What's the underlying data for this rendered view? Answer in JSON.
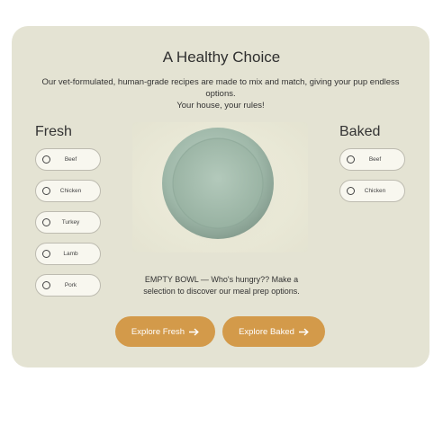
{
  "header": {
    "title": "A Healthy Choice",
    "description_line1": "Our vet-formulated, human-grade recipes are made to mix and match, giving your pup endless options.",
    "description_line2": "Your house, your rules!"
  },
  "fresh": {
    "title": "Fresh",
    "options": [
      "Beef",
      "Chicken",
      "Turkey",
      "Lamb",
      "Pork"
    ]
  },
  "baked": {
    "title": "Baked",
    "options": [
      "Beef",
      "Chicken"
    ]
  },
  "bowl": {
    "status_text": "EMPTY BOWL — Who's hungry?? Make a selection to discover our meal prep options."
  },
  "buttons": {
    "explore_fresh": "Explore Fresh",
    "explore_baked": "Explore Baked"
  },
  "icons": {
    "radio": "radio-unchecked-icon",
    "arrow": "arrow-right-icon"
  },
  "colors": {
    "card_bg": "#e4e3d3",
    "button_bg": "#d39a4a",
    "bowl": "#a9c0b2"
  }
}
